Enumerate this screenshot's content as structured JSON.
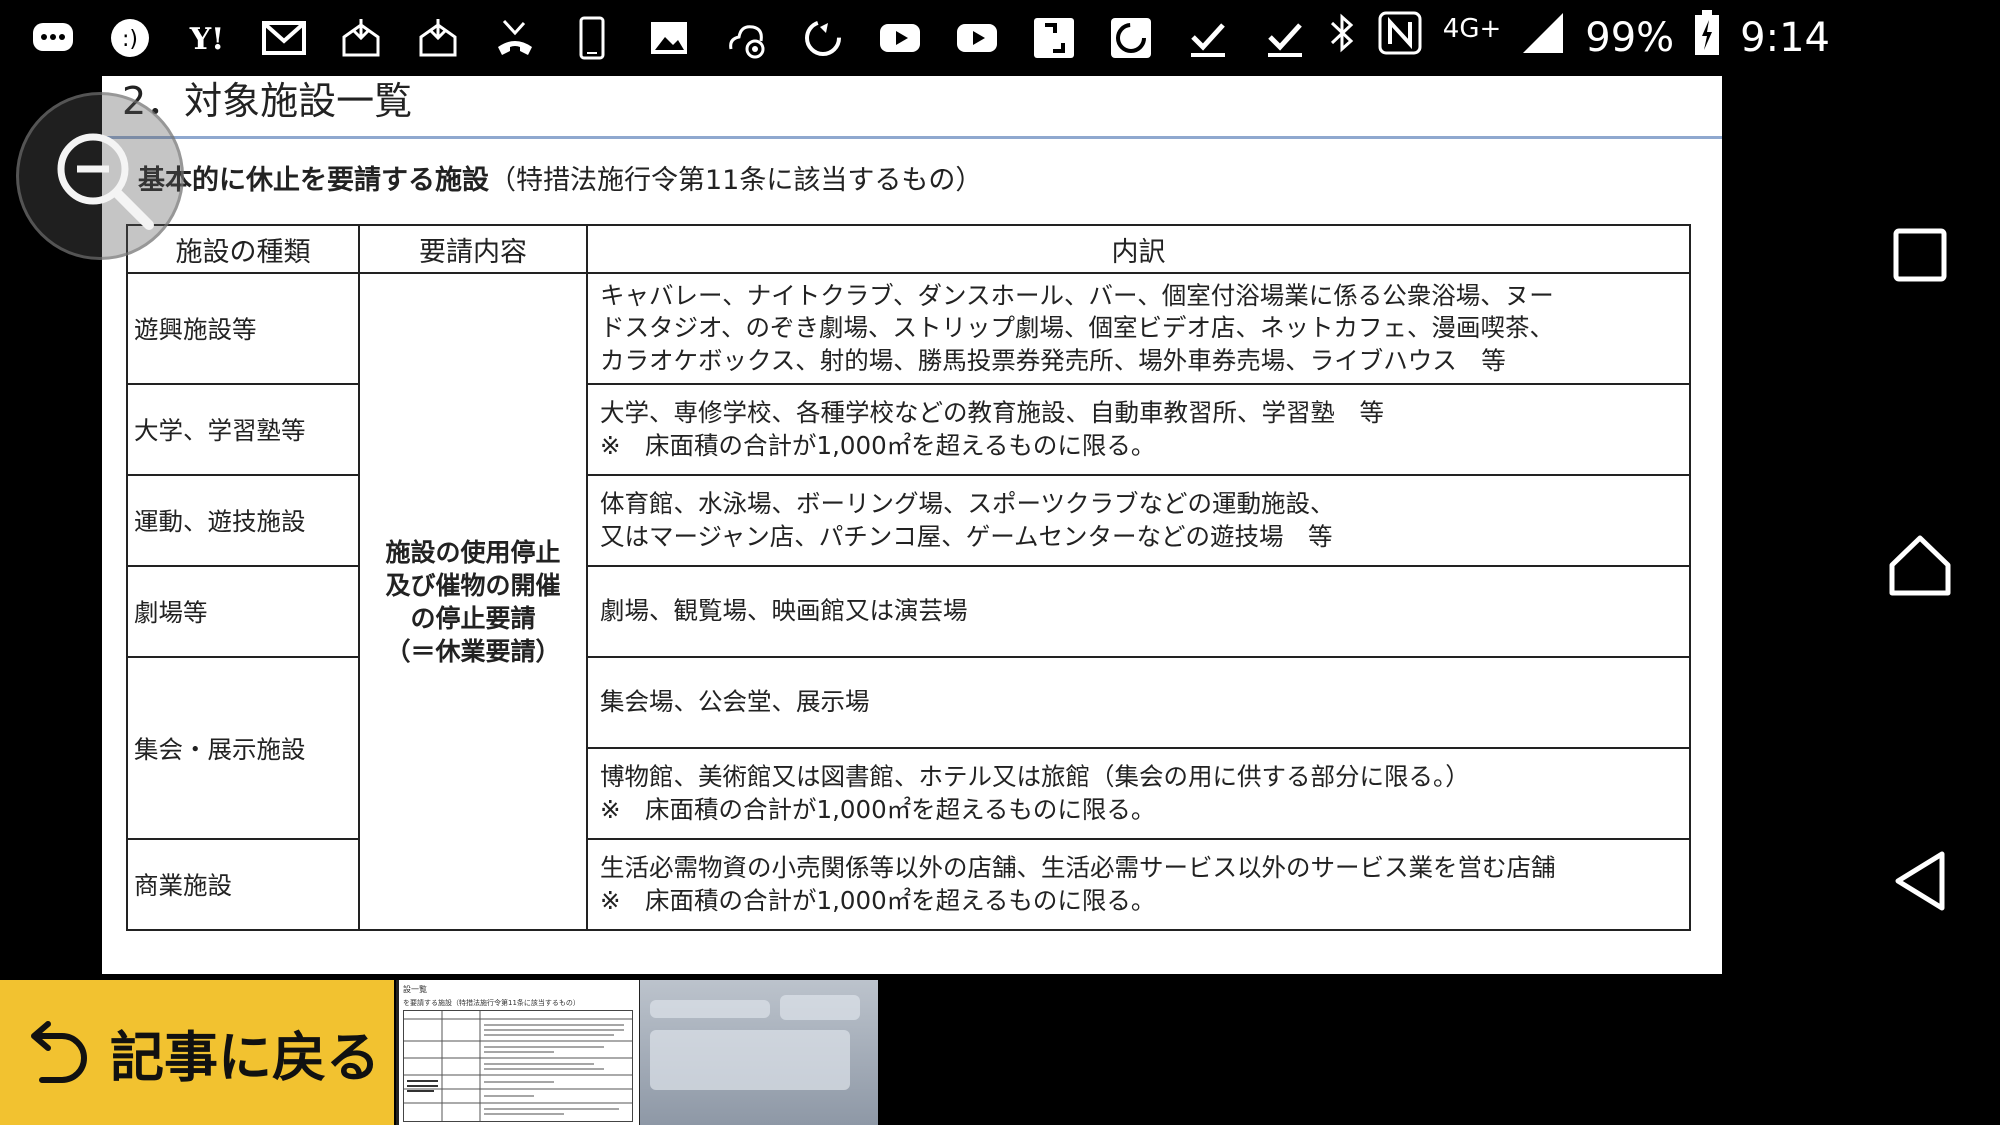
{
  "status_bar": {
    "notification_icons": [
      "chat-bubble-icon",
      "chat-smile-icon",
      "yahoo-icon",
      "gmail-icon",
      "mail-download-icon",
      "mail-download-icon",
      "missed-call-icon",
      "phone-device-icon",
      "image-icon",
      "settings-cloud-icon",
      "sync-icon",
      "youtube-icon",
      "youtube-icon",
      "bracket-app-icon",
      "c-app-icon",
      "checkmark-icon",
      "checkmark-icon"
    ],
    "network": "4G+",
    "battery": "99%",
    "time": "9:14"
  },
  "document": {
    "heading": "2．対象施設一覧",
    "subtitle_bold": "基本的に休止を要請する施設",
    "subtitle_rest": "（特措法施行令第11条に該当するもの）",
    "table": {
      "headers": [
        "施設の種類",
        "要請内容",
        "内訳"
      ],
      "request_text": [
        "施設の使用停止",
        "及び催物の開催",
        "の停止要請",
        "（＝休業要請）"
      ],
      "rows": [
        {
          "kind": "遊興施設等",
          "detail": [
            "キャバレー、ナイトクラブ、ダンスホール、バー、個室付浴場業に係る公衆浴場、ヌー",
            "ドスタジオ、のぞき劇場、ストリップ劇場、個室ビデオ店、ネットカフェ、漫画喫茶、",
            "カラオケボックス、射的場、勝馬投票券発売所、場外車券売場、ライブハウス　等"
          ]
        },
        {
          "kind": "大学、学習塾等",
          "detail": [
            "大学、専修学校、各種学校などの教育施設、自動車教習所、学習塾　等",
            "※　床面積の合計が1,000㎡を超えるものに限る。"
          ]
        },
        {
          "kind": "運動、遊技施設",
          "detail": [
            "体育館、水泳場、ボーリング場、スポーツクラブなどの運動施設、",
            "又はマージャン店、パチンコ屋、ゲームセンターなどの遊技場　等"
          ]
        },
        {
          "kind": "劇場等",
          "detail": [
            "劇場、観覧場、映画館又は演芸場"
          ]
        },
        {
          "kind": "集会・展示施設",
          "detail": [
            "集会場、公会堂、展示場"
          ]
        },
        {
          "kind": "",
          "detail": [
            "博物館、美術館又は図書館、ホテル又は旅館（集会の用に供する部分に限る。）",
            "※　床面積の合計が1,000㎡を超えるものに限る。"
          ]
        },
        {
          "kind": "商業施設",
          "detail": [
            "生活必需物資の小売関係等以外の店舗、生活必需サービス以外のサービス業を営む店舗",
            "※　床面積の合計が1,000㎡を超えるものに限る。"
          ]
        }
      ]
    }
  },
  "zoom_button": {
    "icon": "zoom-out-icon"
  },
  "nav": {
    "recents": "square-icon",
    "home": "home-icon",
    "back": "back-triangle-icon"
  },
  "bottom": {
    "back_label": "記事に戻る",
    "thumb1_title": "設一覧",
    "thumb1_sub": "を要請する施設（特措法施行令第11条に該当するもの）"
  }
}
